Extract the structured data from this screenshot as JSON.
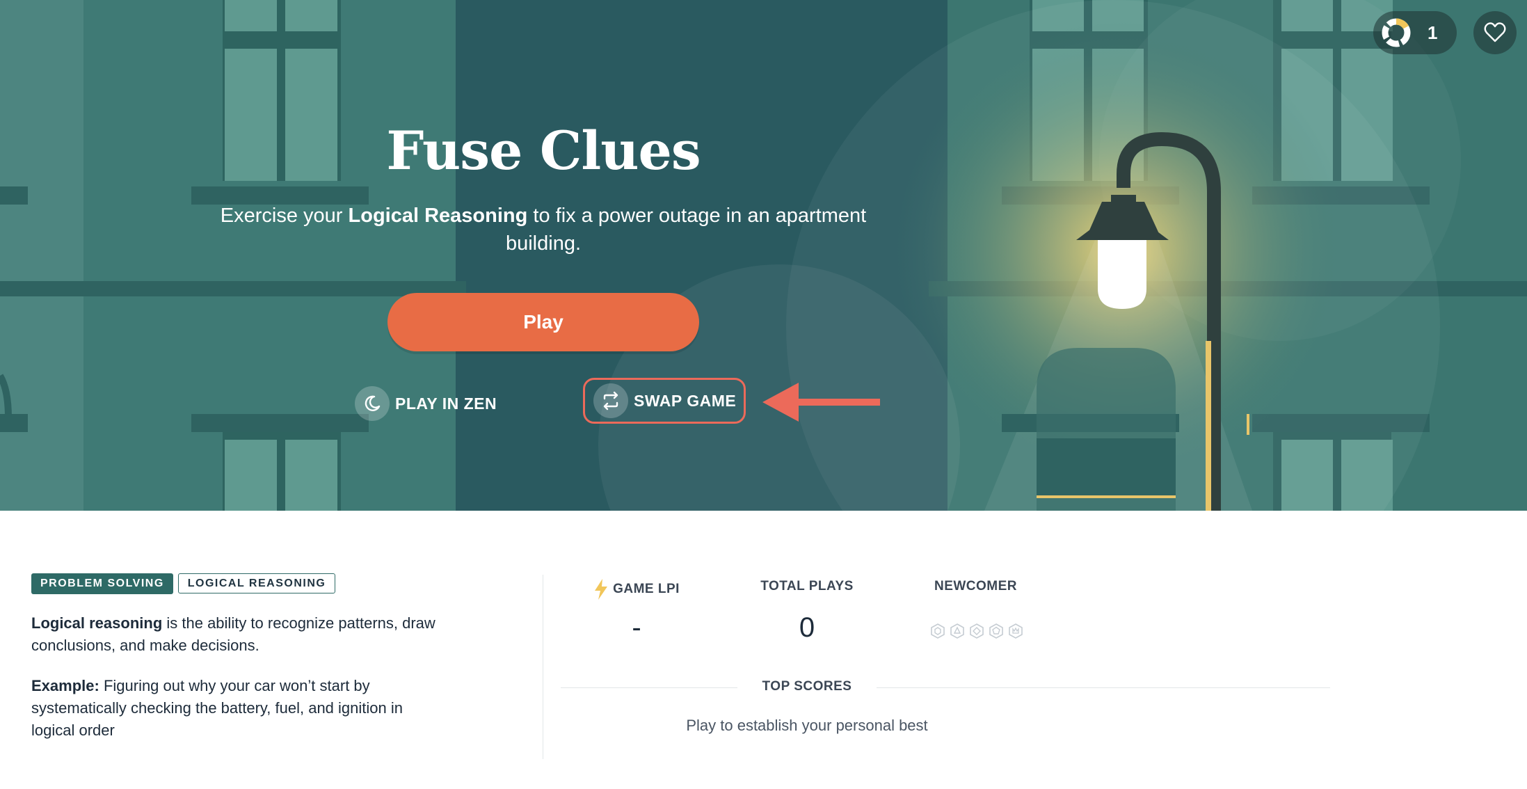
{
  "game": {
    "title": "Fuse Clues",
    "subtitle_pre": "Exercise your ",
    "subtitle_bold": "Logical Reasoning",
    "subtitle_post": " to fix a power outage in an apartment building.",
    "play_label": "Play",
    "zen_label": "PLAY IN ZEN",
    "swap_label": "SWAP GAME"
  },
  "topbar": {
    "streak_count": "1"
  },
  "tags": [
    "PROBLEM SOLVING",
    "LOGICAL REASONING"
  ],
  "description": {
    "term": "Logical reasoning",
    "definition": " is the ability to recognize patterns, draw conclusions, and make decisions.",
    "example_label": "Example:",
    "example_text": " Figuring out why your car won’t start by systematically checking the battery, fuel, and ignition in logical order"
  },
  "stats": {
    "lpi_label": "GAME LPI",
    "lpi_value": "-",
    "plays_label": "TOTAL PLAYS",
    "plays_value": "0",
    "rank_label": "NEWCOMER",
    "top_scores_label": "TOP SCORES",
    "personal_best": "Play to establish your personal best"
  },
  "colors": {
    "accent": "#e86c45",
    "hero_bg": "#2f5e60",
    "tag": "#2e6a66",
    "highlight": "#ec6a5a"
  }
}
